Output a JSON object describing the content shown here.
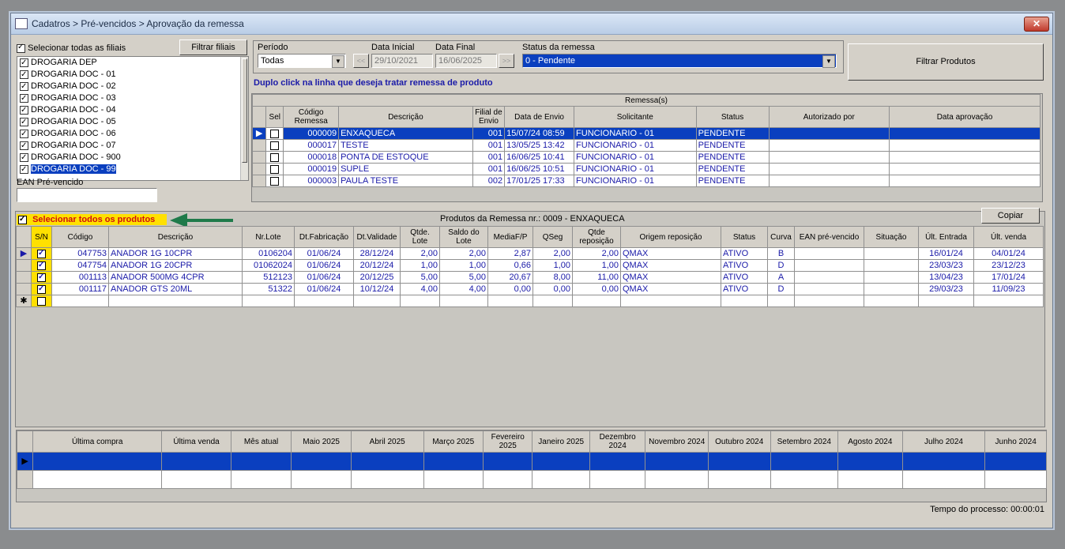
{
  "window": {
    "title": "Cadatros > Pré-vencidos > Aprovação da remessa",
    "close": "✕"
  },
  "branches": {
    "select_all_label": "Selecionar todas as filiais",
    "filter_button": "Filtrar filiais",
    "items": [
      {
        "label": "DROGARIA DEP",
        "checked": true,
        "selected": false
      },
      {
        "label": "DROGARIA DOC - 01",
        "checked": true,
        "selected": false
      },
      {
        "label": "DROGARIA DOC - 02",
        "checked": true,
        "selected": false
      },
      {
        "label": "DROGARIA DOC - 03",
        "checked": true,
        "selected": false
      },
      {
        "label": "DROGARIA DOC - 04",
        "checked": true,
        "selected": false
      },
      {
        "label": "DROGARIA DOC - 05",
        "checked": true,
        "selected": false
      },
      {
        "label": "DROGARIA DOC - 06",
        "checked": true,
        "selected": false
      },
      {
        "label": "DROGARIA DOC - 07",
        "checked": true,
        "selected": false
      },
      {
        "label": "DROGARIA DOC - 900",
        "checked": true,
        "selected": false
      },
      {
        "label": "DROGARIA DOC - 99",
        "checked": true,
        "selected": true
      }
    ],
    "ean_label": "EAN Pré-vencido",
    "ean_value": ""
  },
  "filters": {
    "periodo_label": "Período",
    "periodo_value": "Todas",
    "data_inicial_label": "Data Inicial",
    "data_inicial_value": "29/10/2021",
    "data_final_label": "Data Final",
    "data_final_value": "16/06/2025",
    "prev_btn": "<<",
    "next_btn": ">>",
    "status_label": "Status da remessa",
    "status_value": "0 - Pendente",
    "filtrar_produtos": "Filtrar Produtos"
  },
  "hint": "Duplo click na linha que deseja tratar remessa de produto",
  "remessas": {
    "group_header": "Remessa(s)",
    "columns": [
      "Sel",
      "Código Remessa",
      "Descrição",
      "Filial de Envio",
      "Data de Envio",
      "Solicitante",
      "Status",
      "Autorizado por",
      "Data aprovação"
    ],
    "rows": [
      {
        "codigo": "000009",
        "descricao": "ENXAQUECA",
        "filial": "001",
        "data": "15/07/24 08:59",
        "solicitante": "FUNCIONARIO - 01",
        "status": "PENDENTE",
        "autorizado": "",
        "aprovacao": ""
      },
      {
        "codigo": "000017",
        "descricao": "TESTE",
        "filial": "001",
        "data": "13/05/25 13:42",
        "solicitante": "FUNCIONARIO - 01",
        "status": "PENDENTE",
        "autorizado": "",
        "aprovacao": ""
      },
      {
        "codigo": "000018",
        "descricao": "PONTA DE ESTOQUE",
        "filial": "001",
        "data": "16/06/25 10:41",
        "solicitante": "FUNCIONARIO - 01",
        "status": "PENDENTE",
        "autorizado": "",
        "aprovacao": ""
      },
      {
        "codigo": "000019",
        "descricao": "SUPLE",
        "filial": "001",
        "data": "16/06/25 10:51",
        "solicitante": "FUNCIONARIO - 01",
        "status": "PENDENTE",
        "autorizado": "",
        "aprovacao": ""
      },
      {
        "codigo": "000003",
        "descricao": "PAULA TESTE",
        "filial": "002",
        "data": "17/01/25 17:33",
        "solicitante": "FUNCIONARIO - 01",
        "status": "PENDENTE",
        "autorizado": "",
        "aprovacao": ""
      }
    ]
  },
  "produtos": {
    "select_all_label": "Selecionar todos os produtos",
    "title": "Produtos da Remessa nr.: 0009 - ENXAQUECA",
    "copy_button": "Copiar",
    "columns": [
      "S/N",
      "Código",
      "Descrição",
      "Nr.Lote",
      "Dt.Fabricação",
      "Dt.Validade",
      "Qtde. Lote",
      "Saldo do Lote",
      "MediaF/P",
      "QSeg",
      "Qtde reposição",
      "Origem reposição",
      "Status",
      "Curva",
      "EAN pré-vencido",
      "Situação",
      "Últ. Entrada",
      "Últ. venda"
    ],
    "rows": [
      {
        "codigo": "047753",
        "descricao": "ANADOR 1G 10CPR",
        "lote": "0106204",
        "fab": "01/06/24",
        "val": "28/12/24",
        "qtde": "2,00",
        "saldo": "2,00",
        "media": "2,87",
        "qseg": "2,00",
        "repos": "2,00",
        "origem": "QMAX",
        "status": "ATIVO",
        "curva": "B",
        "ean": "",
        "situacao": "",
        "entrada": "16/01/24",
        "venda": "04/01/24"
      },
      {
        "codigo": "047754",
        "descricao": "ANADOR 1G 20CPR",
        "lote": "01062024",
        "fab": "01/06/24",
        "val": "20/12/24",
        "qtde": "1,00",
        "saldo": "1,00",
        "media": "0,66",
        "qseg": "1,00",
        "repos": "1,00",
        "origem": "QMAX",
        "status": "ATIVO",
        "curva": "D",
        "ean": "",
        "situacao": "",
        "entrada": "23/03/23",
        "venda": "23/12/23"
      },
      {
        "codigo": "001113",
        "descricao": "ANADOR 500MG 4CPR",
        "lote": "512123",
        "fab": "01/06/24",
        "val": "20/12/25",
        "qtde": "5,00",
        "saldo": "5,00",
        "media": "20,67",
        "qseg": "8,00",
        "repos": "11,00",
        "origem": "QMAX",
        "status": "ATIVO",
        "curva": "A",
        "ean": "",
        "situacao": "",
        "entrada": "13/04/23",
        "venda": "17/01/24"
      },
      {
        "codigo": "001117",
        "descricao": "ANADOR GTS 20ML",
        "lote": "51322",
        "fab": "01/06/24",
        "val": "10/12/24",
        "qtde": "4,00",
        "saldo": "4,00",
        "media": "0,00",
        "qseg": "0,00",
        "repos": "0,00",
        "origem": "QMAX",
        "status": "ATIVO",
        "curva": "D",
        "ean": "",
        "situacao": "",
        "entrada": "29/03/23",
        "venda": "11/09/23"
      }
    ]
  },
  "historico": {
    "columns": [
      "Última compra",
      "Última venda",
      "Mês atual",
      "Maio 2025",
      "Abril 2025",
      "Março 2025",
      "Fevereiro 2025",
      "Janeiro 2025",
      "Dezembro 2024",
      "Novembro 2024",
      "Outubro 2024",
      "Setembro 2024",
      "Agosto 2024",
      "Julho 2024",
      "Junho 2024"
    ]
  },
  "status_bar": "Tempo do processo: 00:00:01",
  "colors": {
    "selection": "#0a3fbf",
    "highlight": "#ffe000",
    "arrow": "#1f7a4a",
    "grid_text": "#1a1aa8"
  }
}
